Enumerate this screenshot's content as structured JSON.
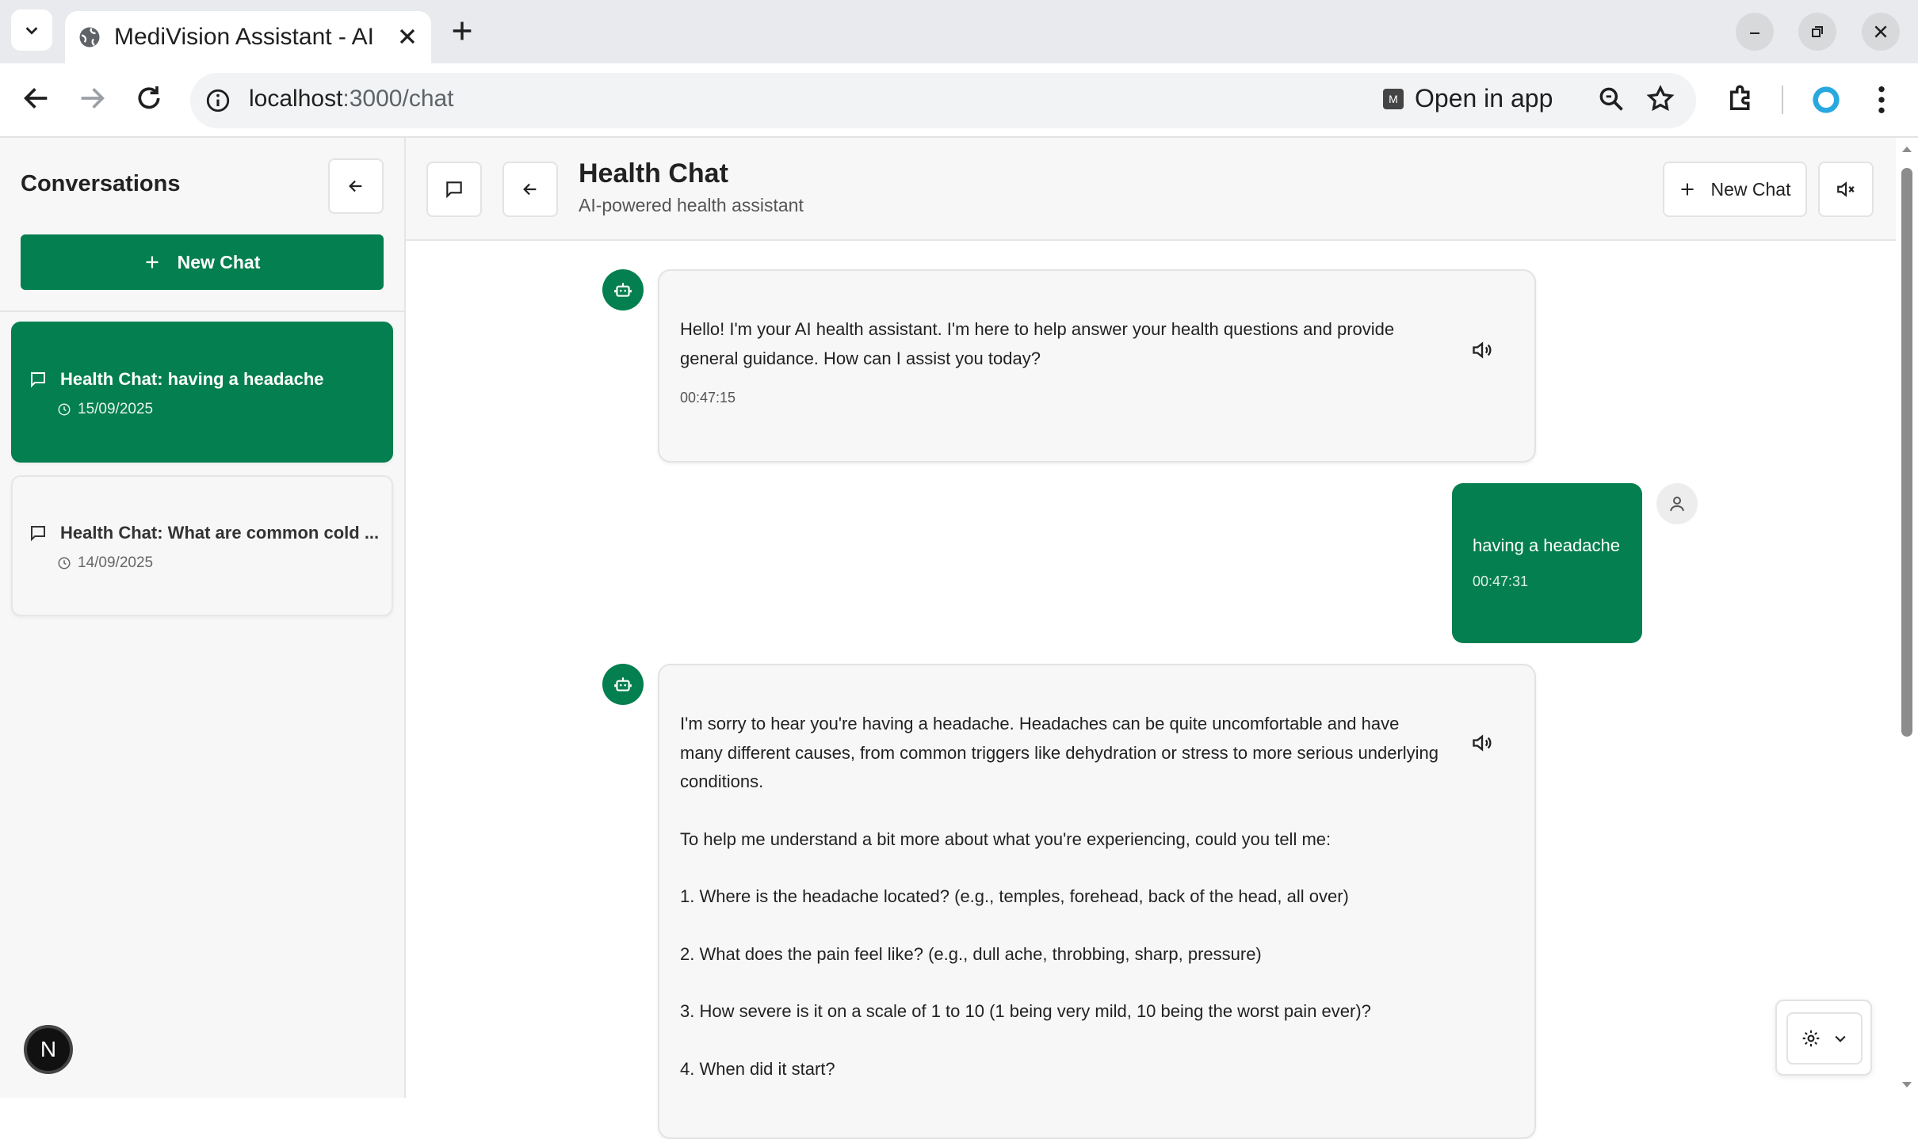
{
  "browser": {
    "tab_title": "MediVision Assistant - AI",
    "url_host": "localhost",
    "url_path": ":3000/chat",
    "open_in_app": "Open in app",
    "app_badge": "M"
  },
  "sidebar": {
    "title": "Conversations",
    "new_chat_label": "New Chat",
    "conversations": [
      {
        "title": "Health Chat: having a headache",
        "date": "15/09/2025",
        "active": true
      },
      {
        "title": "Health Chat: What are common cold ...",
        "date": "14/09/2025",
        "active": false
      }
    ],
    "dev_badge": "N"
  },
  "header": {
    "title": "Health Chat",
    "subtitle": "AI-powered health assistant",
    "new_chat_label": "New Chat"
  },
  "messages": [
    {
      "role": "assistant",
      "text": "Hello! I'm your AI health assistant. I'm here to help answer your health questions and provide general guidance. How can I assist you today?",
      "time": "00:47:15"
    },
    {
      "role": "user",
      "text": "having a headache",
      "time": "00:47:31"
    },
    {
      "role": "assistant",
      "intro": "I'm sorry to hear you're having a headache. Headaches can be quite uncomfortable and have many different causes, from common triggers like dehydration or stress to more serious underlying conditions.",
      "question_lead": "To help me understand a bit more about what you're experiencing, could you tell me:",
      "questions": [
        "1.  Where is the headache located? (e.g., temples, forehead, back of the head, all over)",
        "2.  What does the pain feel like? (e.g., dull ache, throbbing, sharp, pressure)",
        "3.  How severe is it on a scale of 1 to 10 (1 being very mild, 10 being the worst pain ever)?",
        "4.  When did it start?"
      ]
    }
  ],
  "colors": {
    "brand_green": "#047f4f",
    "sidebar_bg": "#f7f7f7"
  },
  "icons": [
    "tab-list-icon",
    "globe-icon",
    "close-icon",
    "plus-icon",
    "back-icon",
    "forward-icon",
    "reload-icon",
    "info-icon",
    "search-icon",
    "star-icon",
    "extensions-icon",
    "profile-icon",
    "menu-icon",
    "message-icon",
    "arrow-left-icon",
    "bot-icon",
    "speaker-icon",
    "user-icon",
    "mute-icon",
    "gear-icon",
    "chevron-down-icon",
    "clock-icon"
  ]
}
